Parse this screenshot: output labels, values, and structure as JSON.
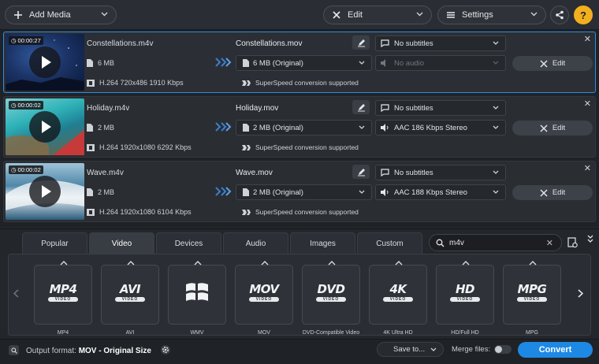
{
  "toolbar": {
    "add_media": "Add Media",
    "edit": "Edit",
    "settings": "Settings"
  },
  "files": [
    {
      "duration": "00:00:27",
      "source_name": "Constellations.m4v",
      "source_size": "6 MB",
      "source_info": "H.264 720x486 1910 Kbps",
      "output_name": "Constellations.mov",
      "output_size": "6 MB (Original)",
      "subtitles": "No subtitles",
      "audio": "No audio",
      "superspeed": "SuperSpeed conversion supported",
      "edit": "Edit"
    },
    {
      "duration": "00:00:02",
      "source_name": "Holiday.m4v",
      "source_size": "2 MB",
      "source_info": "H.264 1920x1080 6292 Kbps",
      "output_name": "Holiday.mov",
      "output_size": "2 MB (Original)",
      "subtitles": "No subtitles",
      "audio": "AAC 186 Kbps Stereo",
      "superspeed": "SuperSpeed conversion supported",
      "edit": "Edit"
    },
    {
      "duration": "00:00:02",
      "source_name": "Wave.m4v",
      "source_size": "2 MB",
      "source_info": "H.264 1920x1080 6104 Kbps",
      "output_name": "Wave.mov",
      "output_size": "2 MB (Original)",
      "subtitles": "No subtitles",
      "audio": "AAC 188 Kbps Stereo",
      "superspeed": "SuperSpeed conversion supported",
      "edit": "Edit"
    }
  ],
  "tabs": [
    "Popular",
    "Video",
    "Devices",
    "Audio",
    "Images",
    "Custom"
  ],
  "active_tab": "Video",
  "search": {
    "value": "m4v"
  },
  "presets": [
    {
      "logo": "MP4",
      "sub": "VIDEO",
      "label": "MP4"
    },
    {
      "logo": "AVI",
      "sub": "VIDEO",
      "label": "AVI"
    },
    {
      "logo": "",
      "sub": "",
      "label": "WMV",
      "icon": "windows-logo-icon"
    },
    {
      "logo": "MOV",
      "sub": "VIDEO",
      "label": "MOV"
    },
    {
      "logo": "DVD",
      "sub": "VIDEO",
      "label": "DVD-Compatible Video"
    },
    {
      "logo": "4K",
      "sub": "VIDEO",
      "label": "4K Ultra HD"
    },
    {
      "logo": "HD",
      "sub": "VIDEO",
      "label": "HD/Full HD"
    },
    {
      "logo": "MPG",
      "sub": "VIDEO",
      "label": "MPG"
    }
  ],
  "bottom": {
    "output_label": "Output format:",
    "output_value": "MOV - Original Size",
    "save_to": "Save to...",
    "merge": "Merge files:",
    "convert": "Convert"
  },
  "colors": {
    "accent": "#1e88e5",
    "selected_border": "#2e8ddf"
  }
}
